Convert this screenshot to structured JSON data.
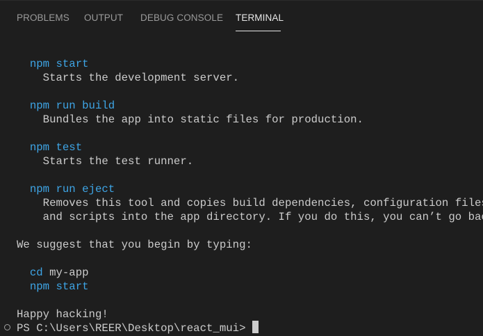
{
  "tabs": [
    {
      "label": "PROBLEMS",
      "active": false
    },
    {
      "label": "OUTPUT",
      "active": false
    },
    {
      "label": "DEBUG CONSOLE",
      "active": false
    },
    {
      "label": "TERMINAL",
      "active": true
    }
  ],
  "terminal": {
    "lines": [
      {
        "indent": "  ",
        "text": "npm start",
        "style": "command"
      },
      {
        "indent": "    ",
        "text": "Starts the development server.",
        "style": "plain"
      },
      {
        "indent": "  ",
        "text": "npm run build",
        "style": "command"
      },
      {
        "indent": "    ",
        "text": "Bundles the app into static files for production.",
        "style": "plain"
      },
      {
        "indent": "  ",
        "text": "npm test",
        "style": "command"
      },
      {
        "indent": "    ",
        "text": "Starts the test runner.",
        "style": "plain"
      },
      {
        "indent": "  ",
        "text": "npm run eject",
        "style": "command"
      },
      {
        "indent": "    ",
        "text": "Removes this tool and copies build dependencies, configuration files",
        "style": "plain"
      },
      {
        "indent": "    ",
        "text": "and scripts into the app directory. If you do this, you can’t go back!",
        "style": "plain"
      },
      {
        "indent": "",
        "text": "We suggest that you begin by typing:",
        "style": "plain"
      },
      {
        "indent": "  ",
        "text": "cd",
        "arg": " my-app",
        "style": "command"
      },
      {
        "indent": "  ",
        "text": "npm start",
        "style": "command"
      },
      {
        "indent": "",
        "text": "Happy hacking!",
        "style": "plain"
      }
    ],
    "prompt": "PS C:\\Users\\REER\\Desktop\\react_mui> "
  },
  "colors": {
    "background": "#1e1e1e",
    "text": "#cccccc",
    "command": "#3ea5e6",
    "tab_inactive": "#9a9a9a",
    "tab_active": "#e7e7e7"
  }
}
